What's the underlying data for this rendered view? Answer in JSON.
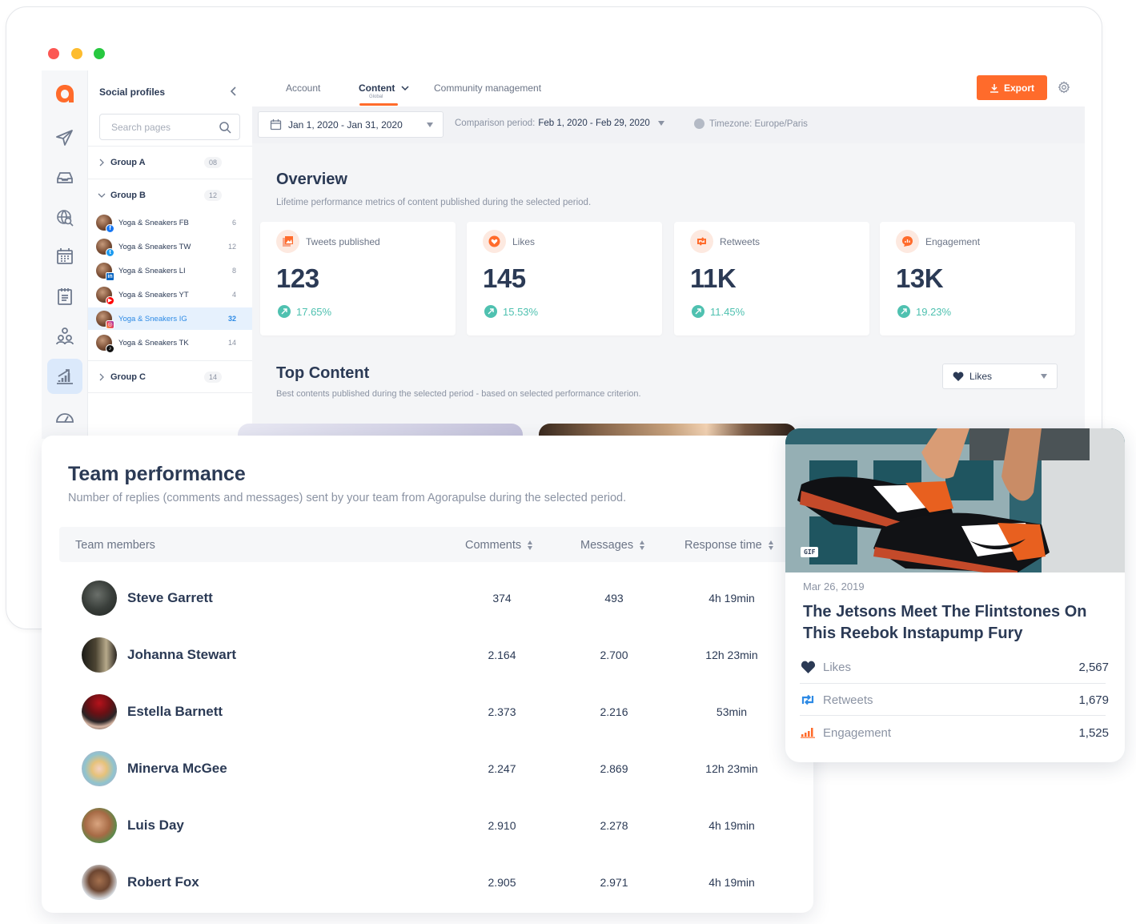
{
  "window": {
    "controls": [
      "close",
      "minimize",
      "maximize"
    ]
  },
  "rail": {
    "items": [
      {
        "name": "publish",
        "icon": "paper-plane-icon"
      },
      {
        "name": "inbox",
        "icon": "inbox-tray-icon"
      },
      {
        "name": "listening",
        "icon": "globe-search-icon"
      },
      {
        "name": "calendar",
        "icon": "calendar-icon"
      },
      {
        "name": "planner",
        "icon": "notepad-icon"
      },
      {
        "name": "team",
        "icon": "users-icon"
      },
      {
        "name": "reports",
        "icon": "chart-growth-icon",
        "active": true
      },
      {
        "name": "dashboard",
        "icon": "speedometer-icon"
      }
    ]
  },
  "profiles": {
    "title": "Social profiles",
    "search_placeholder": "Search pages",
    "groups": [
      {
        "name": "Group A",
        "count": "08",
        "expanded": false
      },
      {
        "name": "Group B",
        "count": "12",
        "expanded": true,
        "items": [
          {
            "name": "Yoga & Sneakers FB",
            "count": "6",
            "network": "facebook"
          },
          {
            "name": "Yoga & Sneakers TW",
            "count": "12",
            "network": "twitter"
          },
          {
            "name": "Yoga & Sneakers LI",
            "count": "8",
            "network": "linkedin"
          },
          {
            "name": "Yoga & Sneakers YT",
            "count": "4",
            "network": "youtube"
          },
          {
            "name": "Yoga & Sneakers IG",
            "count": "32",
            "network": "instagram",
            "active": true
          },
          {
            "name": "Yoga & Sneakers TK",
            "count": "14",
            "network": "tiktok"
          }
        ]
      },
      {
        "name": "Group C",
        "count": "14",
        "expanded": false
      }
    ]
  },
  "topbar": {
    "tabs": [
      {
        "label": "Account"
      },
      {
        "label": "Content",
        "sublabel": "Global",
        "active": true
      },
      {
        "label": "Community management"
      }
    ],
    "export_label": "Export",
    "accent": "#ff6b2b"
  },
  "filters": {
    "date_range": "Jan 1, 2020 - Jan 31, 2020",
    "comparison_label": "Comparison period:",
    "comparison_value": "Feb 1, 2020 - Feb 29, 2020",
    "timezone": "Timezone: Europe/Paris"
  },
  "overview": {
    "title": "Overview",
    "subtitle": "Lifetime performance metrics of content published during the selected period.",
    "kpis": [
      {
        "label": "Tweets published",
        "value": "123",
        "trend": "17.65%",
        "icon": "image-gallery-icon"
      },
      {
        "label": "Likes",
        "value": "145",
        "trend": "15.53%",
        "icon": "heart-icon"
      },
      {
        "label": "Retweets",
        "value": "11K",
        "trend": "11.45%",
        "icon": "retweet-icon"
      },
      {
        "label": "Engagement",
        "value": "13K",
        "trend": "19.23%",
        "icon": "chat-chart-icon"
      }
    ],
    "trend_color": "#4fc1b0"
  },
  "top_content": {
    "title": "Top Content",
    "subtitle": "Best contents published during the selected period - based on selected performance criterion.",
    "criterion": "Likes"
  },
  "team": {
    "title": "Team performance",
    "subtitle": "Number of replies (comments and messages) sent by your team from Agorapulse during the selected period.",
    "columns": [
      "Team members",
      "Comments",
      "Messages",
      "Response time"
    ],
    "rows": [
      {
        "name": "Steve Garrett",
        "comments": "374",
        "messages": "493",
        "response": "4h 19min"
      },
      {
        "name": "Johanna Stewart",
        "comments": "2.164",
        "messages": "2.700",
        "response": "12h 23min"
      },
      {
        "name": "Estella Barnett",
        "comments": "2.373",
        "messages": "2.216",
        "response": "53min"
      },
      {
        "name": "Minerva McGee",
        "comments": "2.247",
        "messages": "2.869",
        "response": "12h 23min"
      },
      {
        "name": "Luis Day",
        "comments": "2.910",
        "messages": "2.278",
        "response": "4h 19min"
      },
      {
        "name": "Robert Fox",
        "comments": "2.905",
        "messages": "2.971",
        "response": "4h 19min"
      }
    ]
  },
  "post": {
    "badge": "GIF",
    "date": "Mar 26, 2019",
    "title": "The Jetsons Meet The Flintstones On This Reebok Instapump Fury",
    "metrics": [
      {
        "label": "Likes",
        "value": "2,567",
        "icon": "heart-icon"
      },
      {
        "label": "Retweets",
        "value": "1,679",
        "icon": "retweet-icon"
      },
      {
        "label": "Engagement",
        "value": "1,525",
        "icon": "bar-chart-icon"
      }
    ]
  }
}
